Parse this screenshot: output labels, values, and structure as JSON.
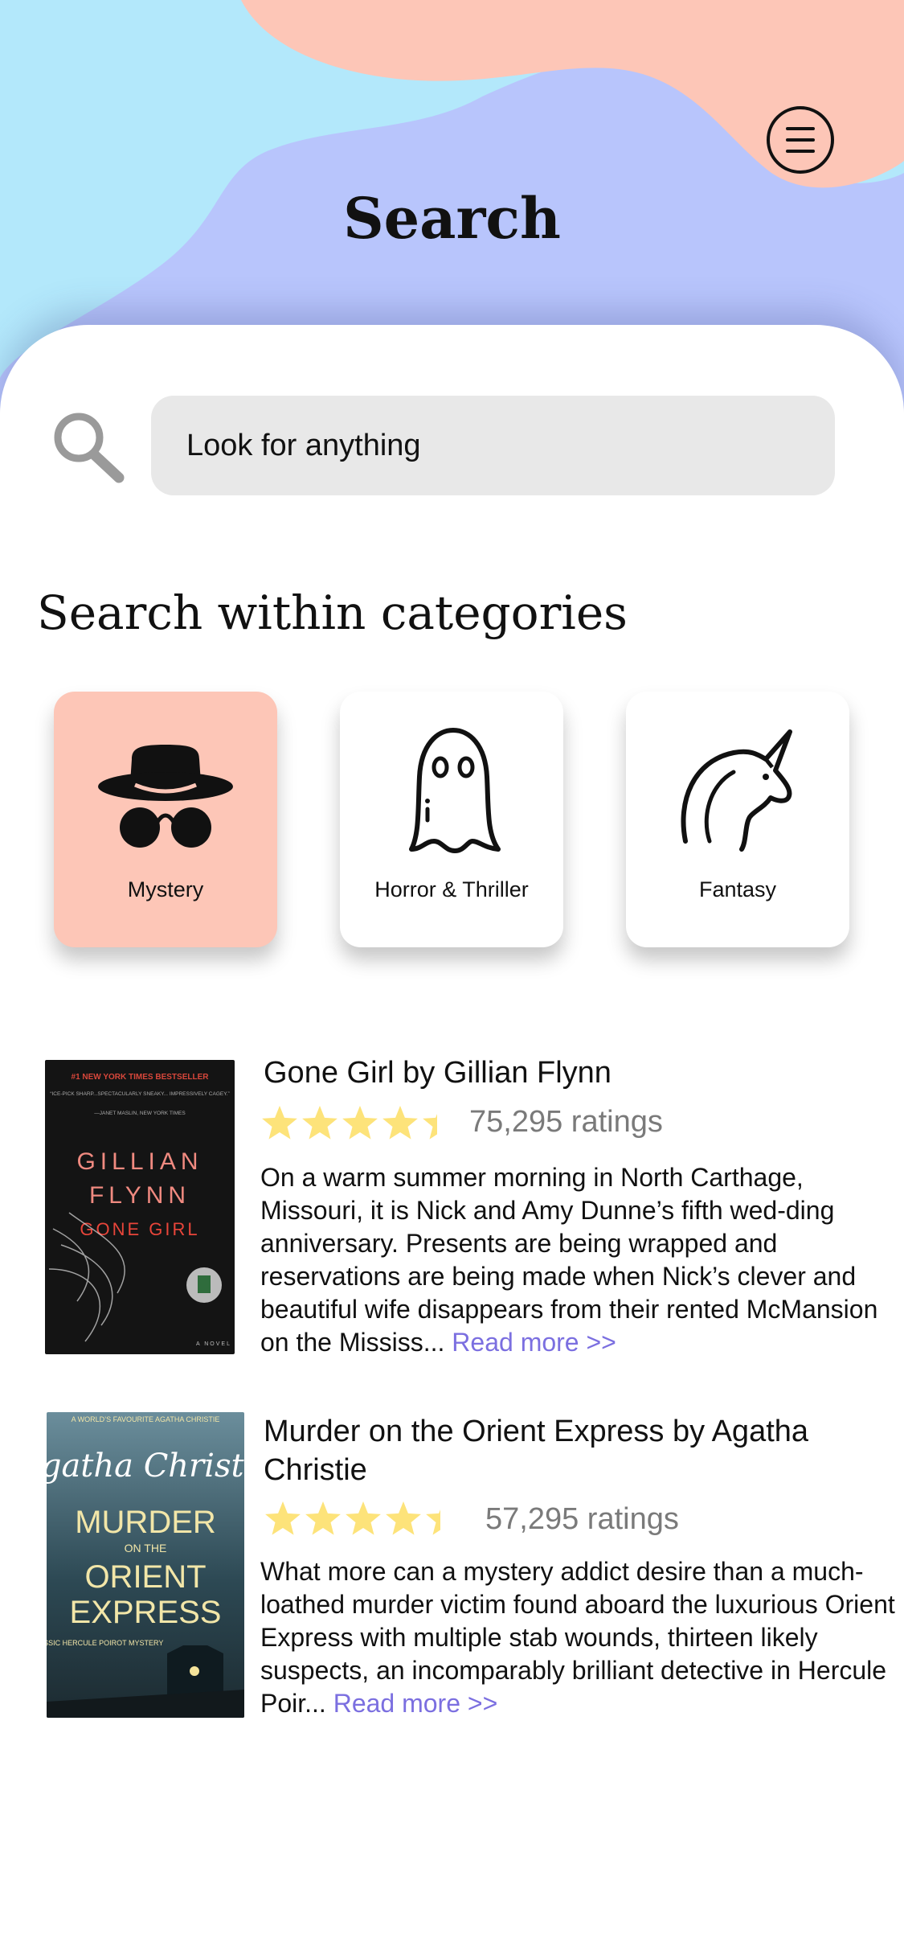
{
  "header": {
    "title": "Search",
    "menu_icon": "hamburger-menu-icon",
    "colors": {
      "sky": "#b3e8fb",
      "lavender": "#b8c5fc",
      "peach": "#fdc6b7"
    }
  },
  "search": {
    "icon": "search-icon",
    "placeholder": "Look for anything"
  },
  "categories": {
    "title": "Search within categories",
    "items": [
      {
        "label": "Mystery",
        "icon": "detective-icon",
        "active": true
      },
      {
        "label": "Horror & Thriller",
        "icon": "ghost-icon",
        "active": false
      },
      {
        "label": "Fantasy",
        "icon": "unicorn-icon",
        "active": false
      }
    ]
  },
  "books": [
    {
      "title": "Gone Girl by  Gillian Flynn",
      "rating_stars": 4.5,
      "ratings": "75,295 ratings",
      "description": "On a warm summer morning in North Carthage, Missouri, it is Nick and Amy Dunne’s fifth wed-ding anniversary. Presents are being wrapped and reservations are being made when Nick’s clever and beautiful wife disappears from their rented McMansion on the Mississ...",
      "read_more": "Read more >>",
      "cover": {
        "top_line": "#1 NEW YORK TIMES BESTSELLER",
        "quote": "“ICE-PICK SHARP...SPECTACULARLY SNEAKY... IMPRESSIVELY CAGEY.”",
        "quote_source": "—JANET MASLIN, NEW YORK TIMES",
        "author_1": "GILLIAN",
        "author_2": "FLYNN",
        "book_title": "GONE GIRL",
        "footer": "A NOVEL"
      }
    },
    {
      "title": "Murder on the Orient Express by Agatha Christie",
      "rating_stars": 4.5,
      "ratings": "57,295 ratings",
      "description": "What more can a mystery addict desire than a much-loathed murder victim found aboard the luxurious Orient Express with multiple stab wounds, thirteen likely suspects, an incomparably brilliant detective in Hercule Poir...",
      "read_more": "Read more >>",
      "cover": {
        "top_line": "A WORLD’S FAVOURITE AGATHA CHRISTIE",
        "author": "Agatha Christie",
        "title_1": "MURDER",
        "title_2": "ON THE",
        "title_3": "ORIENT",
        "title_4": "EXPRESS",
        "footer": "A CLASSIC HERCULE POIROT MYSTERY"
      }
    }
  ],
  "star_color": "#fde37a"
}
